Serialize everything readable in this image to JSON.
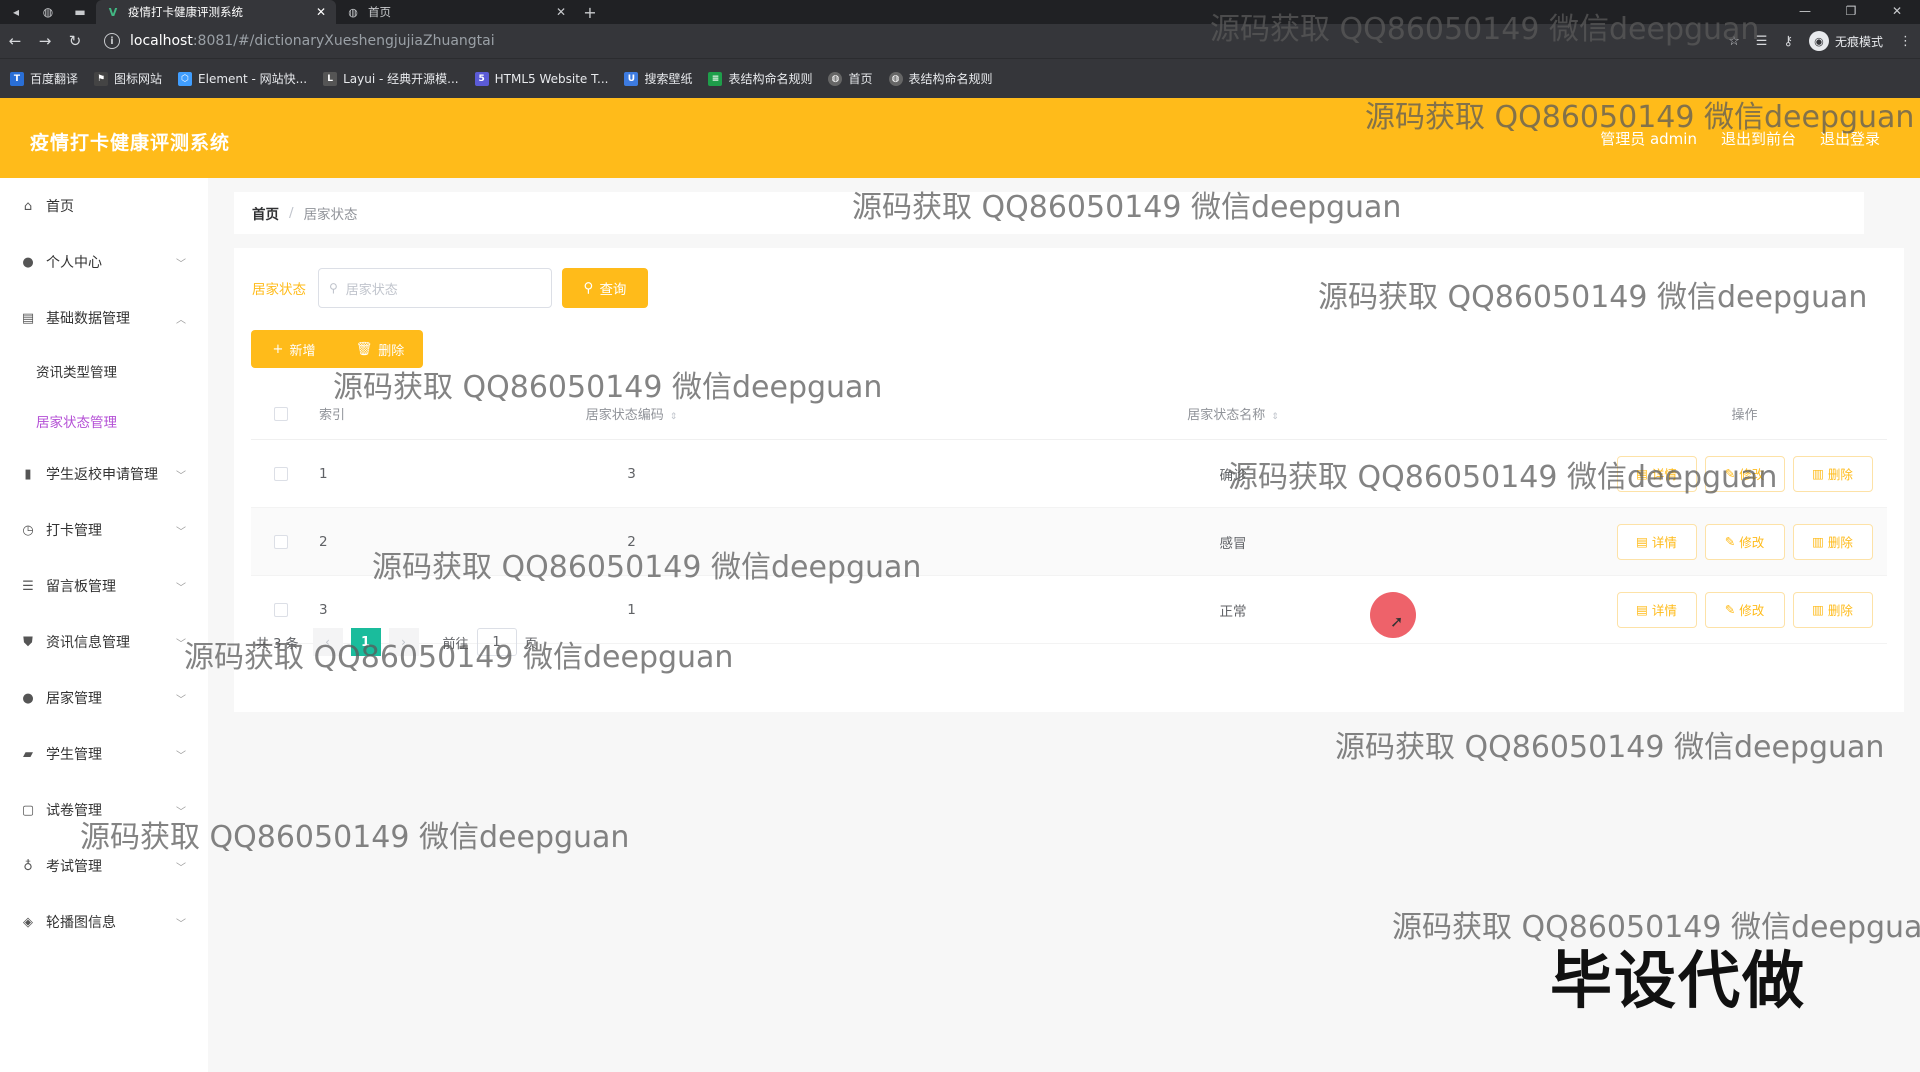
{
  "browser": {
    "tabs": [
      {
        "label": "疫情打卡健康评测系统",
        "icon": "V",
        "active": true
      },
      {
        "label": "首页",
        "icon": "globe",
        "active": false
      }
    ],
    "url_host": "localhost",
    "url_path": ":8081/#/dictionaryXueshengjujiaZhuangtai",
    "incognito_label": "无痕模式",
    "bookmarks": [
      {
        "label": "百度翻译",
        "icon_color": "#2a6fd6"
      },
      {
        "label": "图标网站",
        "icon_color": "#444444"
      },
      {
        "label": "Element - 网站快...",
        "icon_color": "#409eff"
      },
      {
        "label": "Layui - 经典开源模...",
        "icon_color": "#555555"
      },
      {
        "label": "HTML5 Website T...",
        "icon_color": "#5b5bd6"
      },
      {
        "label": "搜索壁纸",
        "icon_color": "#3d7be0"
      },
      {
        "label": "表结构命名规则",
        "icon_color": "#1e9e4a"
      },
      {
        "label": "首页",
        "icon_color": "#666666"
      },
      {
        "label": "表结构命名规则",
        "icon_color": "#666666"
      }
    ]
  },
  "header": {
    "title": "疫情打卡健康评测系统",
    "user_label": "管理员 admin",
    "frontend_link": "退出到前台",
    "logout_link": "退出登录",
    "accent_color": "#ffbb1a"
  },
  "sidebar": {
    "items": [
      {
        "label": "首页",
        "icon": "home-icon",
        "has_arrow": false
      },
      {
        "label": "个人中心",
        "icon": "user-icon",
        "has_arrow": true
      },
      {
        "label": "基础数据管理",
        "icon": "list-icon",
        "has_arrow": true,
        "expanded": true,
        "children": [
          {
            "label": "资讯类型管理",
            "active": false
          },
          {
            "label": "居家状态管理",
            "active": true
          }
        ]
      },
      {
        "label": "学生返校申请管理",
        "icon": "bar-chart-icon",
        "has_arrow": true
      },
      {
        "label": "打卡管理",
        "icon": "clock-icon",
        "has_arrow": true
      },
      {
        "label": "留言板管理",
        "icon": "sliders-icon",
        "has_arrow": true
      },
      {
        "label": "资讯信息管理",
        "icon": "shield-icon",
        "has_arrow": true
      },
      {
        "label": "居家管理",
        "icon": "user-icon",
        "has_arrow": true
      },
      {
        "label": "学生管理",
        "icon": "student-icon",
        "has_arrow": true
      },
      {
        "label": "试卷管理",
        "icon": "square-icon",
        "has_arrow": true
      },
      {
        "label": "考试管理",
        "icon": "mic-icon",
        "has_arrow": true
      },
      {
        "label": "轮播图信息",
        "icon": "image-icon",
        "has_arrow": true
      }
    ]
  },
  "breadcrumb": {
    "home": "首页",
    "current": "居家状态"
  },
  "search": {
    "label": "居家状态",
    "placeholder": "居家状态",
    "button": "查询"
  },
  "actions": {
    "add": "新增",
    "delete": "删除"
  },
  "table": {
    "headers": {
      "index": "索引",
      "code": "居家状态编码",
      "name": "居家状态名称",
      "ops": "操作"
    },
    "rows": [
      {
        "index": "1",
        "code": "3",
        "name": "确诊"
      },
      {
        "index": "2",
        "code": "2",
        "name": "感冒"
      },
      {
        "index": "3",
        "code": "1",
        "name": "正常"
      }
    ],
    "op_labels": {
      "detail": "详情",
      "edit": "修改",
      "delete": "删除"
    }
  },
  "pagination": {
    "total": "共 3 条",
    "current": "1",
    "goto_prefix": "前往",
    "goto_value": "1",
    "goto_suffix": "页"
  },
  "overlay": {
    "watermark": "源码获取 QQ86050149 微信deepguan",
    "stamp": "毕设代做"
  }
}
